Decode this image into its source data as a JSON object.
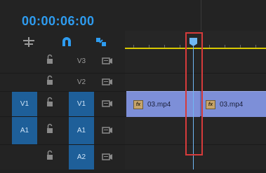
{
  "timecode": "00:00:06:00",
  "tools": [
    "insert-track-icon",
    "snap-magnet-icon",
    "linked-selection-icon"
  ],
  "tracks": [
    {
      "id": "V3",
      "source": "",
      "name": "V3"
    },
    {
      "id": "V2",
      "source": "",
      "name": "V2"
    },
    {
      "id": "V1",
      "source": "V1",
      "name": "V1"
    },
    {
      "id": "A1",
      "source": "A1",
      "name": "A1"
    },
    {
      "id": "A2",
      "source": "",
      "name": "A2"
    }
  ],
  "clips": [
    {
      "label": "03.mp4",
      "badge": "fx"
    },
    {
      "label": "03.mp4",
      "badge": "fx"
    }
  ],
  "colors": {
    "accent": "#2e9cf0",
    "playhead": "#6fb7f5",
    "highlight": "#d63b3b",
    "clip": "#7d8fd8",
    "work_area": "#d8c800"
  }
}
